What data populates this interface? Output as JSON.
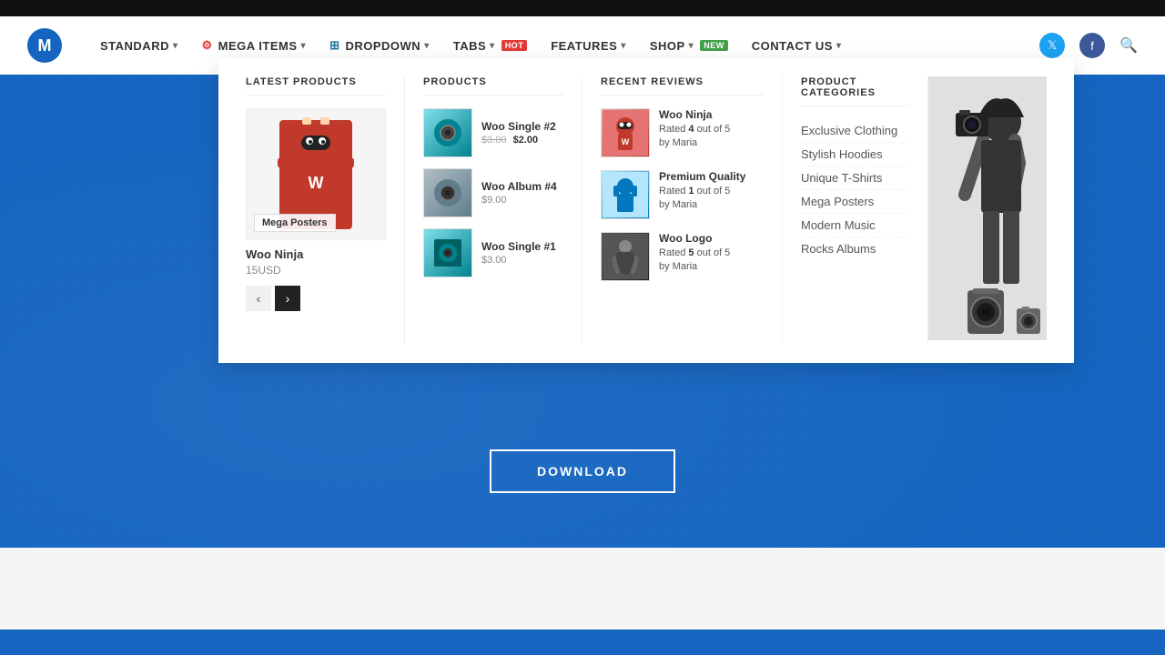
{
  "topbar": {},
  "navbar": {
    "logo_letter": "M",
    "items": [
      {
        "label": "STANDARD",
        "has_dropdown": true
      },
      {
        "label": "MEGA ITEMS",
        "has_dropdown": true,
        "icon": "mega"
      },
      {
        "label": "DROPDOWN",
        "has_dropdown": true,
        "icon": "wp"
      },
      {
        "label": "TABS",
        "has_dropdown": true,
        "badge": "HOT",
        "badge_type": "hot"
      },
      {
        "label": "FEATURES",
        "has_dropdown": true
      },
      {
        "label": "SHOP",
        "has_dropdown": true,
        "badge": "NEW",
        "badge_type": "new"
      },
      {
        "label": "CONTACT US",
        "has_dropdown": true
      }
    ],
    "social": {
      "twitter": "𝕏",
      "facebook": "f"
    }
  },
  "dropdown": {
    "latest_products": {
      "title": "LATEST PRODUCTS",
      "featured": {
        "label": "Mega Posters",
        "name": "Woo Ninja",
        "price": "15USD"
      },
      "nav": {
        "prev": "‹",
        "next": "›"
      }
    },
    "products": {
      "title": "PRODUCTS",
      "items": [
        {
          "name": "Woo Single #2",
          "price_old": "$3.00",
          "price_new": "$2.00",
          "thumb_type": "single2"
        },
        {
          "name": "Woo Album #4",
          "price": "$9.00",
          "thumb_type": "album"
        },
        {
          "name": "Woo Single #1",
          "price": "$3.00",
          "thumb_type": "single1"
        }
      ]
    },
    "recent_reviews": {
      "title": "RECENT REVIEWS",
      "items": [
        {
          "product": "Woo Ninja",
          "rating_text": "Rated",
          "rating_number": "4",
          "rating_suffix": "out of 5",
          "reviewer": "by Maria",
          "thumb_type": "ninja"
        },
        {
          "product": "Premium Quality",
          "rating_text": "Rated",
          "rating_number": "1",
          "rating_suffix": "out of 5",
          "reviewer": "by Maria",
          "thumb_type": "quality"
        },
        {
          "product": "Woo Logo",
          "rating_text": "Rated",
          "rating_number": "5",
          "rating_suffix": "out of 5",
          "reviewer": "by Maria",
          "thumb_type": "logo"
        }
      ]
    },
    "product_categories": {
      "title": "PRODUCT CATEGORIES",
      "items": [
        "Exclusive Clothing",
        "Stylish Hoodies",
        "Unique T-Shirts",
        "Mega Posters",
        "Modern Music",
        "Rocks Albums"
      ]
    }
  },
  "hero": {
    "download_label": "DOWNLOAD"
  }
}
